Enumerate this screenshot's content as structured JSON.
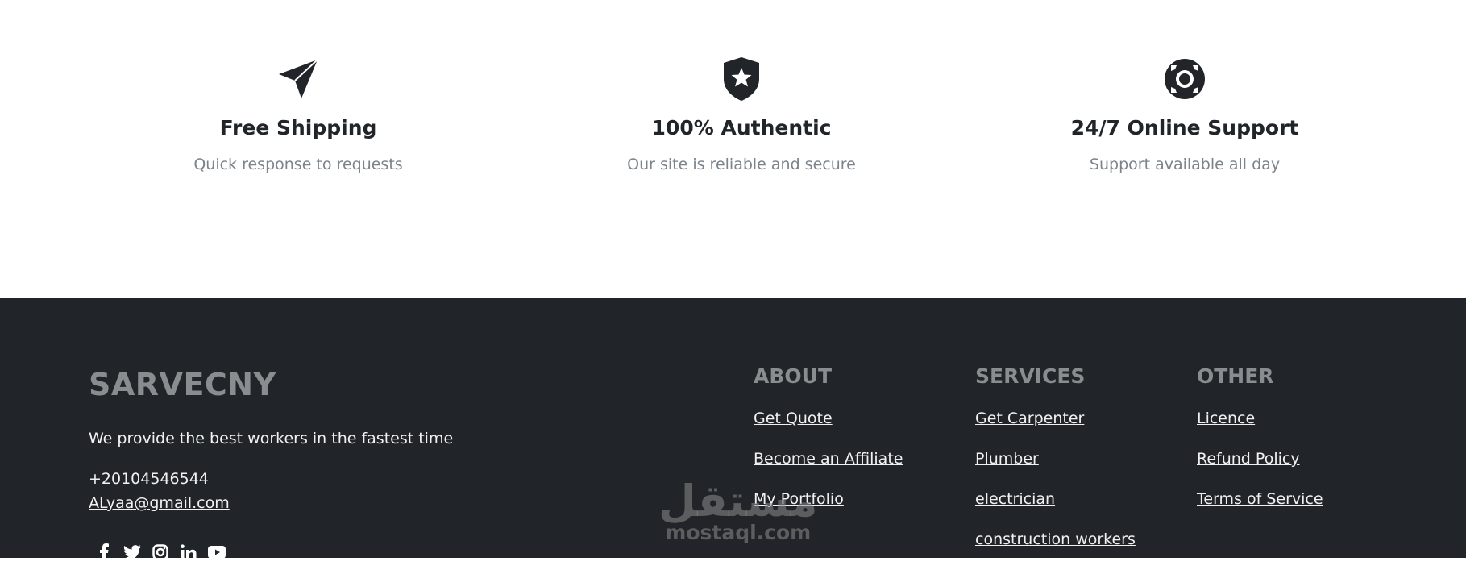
{
  "features": [
    {
      "icon": "paper-plane-icon",
      "title": "Free Shipping",
      "desc": "Quick response to requests"
    },
    {
      "icon": "shield-star-icon",
      "title": "100% Authentic",
      "desc": "Our site is reliable and secure"
    },
    {
      "icon": "life-ring-icon",
      "title": "24/7 Online Support",
      "desc": "Support available all day"
    }
  ],
  "footer": {
    "brand": "SARVECNY",
    "tagline": "We provide the best workers in the fastest time",
    "phone_plus": "+",
    "phone_number": "20104546544",
    "email": "ALyaa@gmail.com",
    "social": [
      "facebook-icon",
      "twitter-icon",
      "instagram-icon",
      "linkedin-icon",
      "youtube-icon"
    ],
    "columns": [
      {
        "heading": "ABOUT",
        "links": [
          "Get Quote",
          "Become an Affiliate",
          "My Portfolio"
        ]
      },
      {
        "heading": "SERVICES",
        "links": [
          "Get Carpenter",
          "Plumber",
          "electrician",
          "construction workers"
        ]
      },
      {
        "heading": "OTHER",
        "links": [
          "Licence",
          "Refund Policy",
          "Terms of Service"
        ]
      }
    ]
  },
  "watermark": {
    "arabic": "مستقل",
    "latin": "mostaql.com"
  },
  "colors": {
    "footer_bg": "#212529",
    "heading_gray": "#8a8d90",
    "text_dark": "#212529",
    "muted": "#7c838a"
  }
}
